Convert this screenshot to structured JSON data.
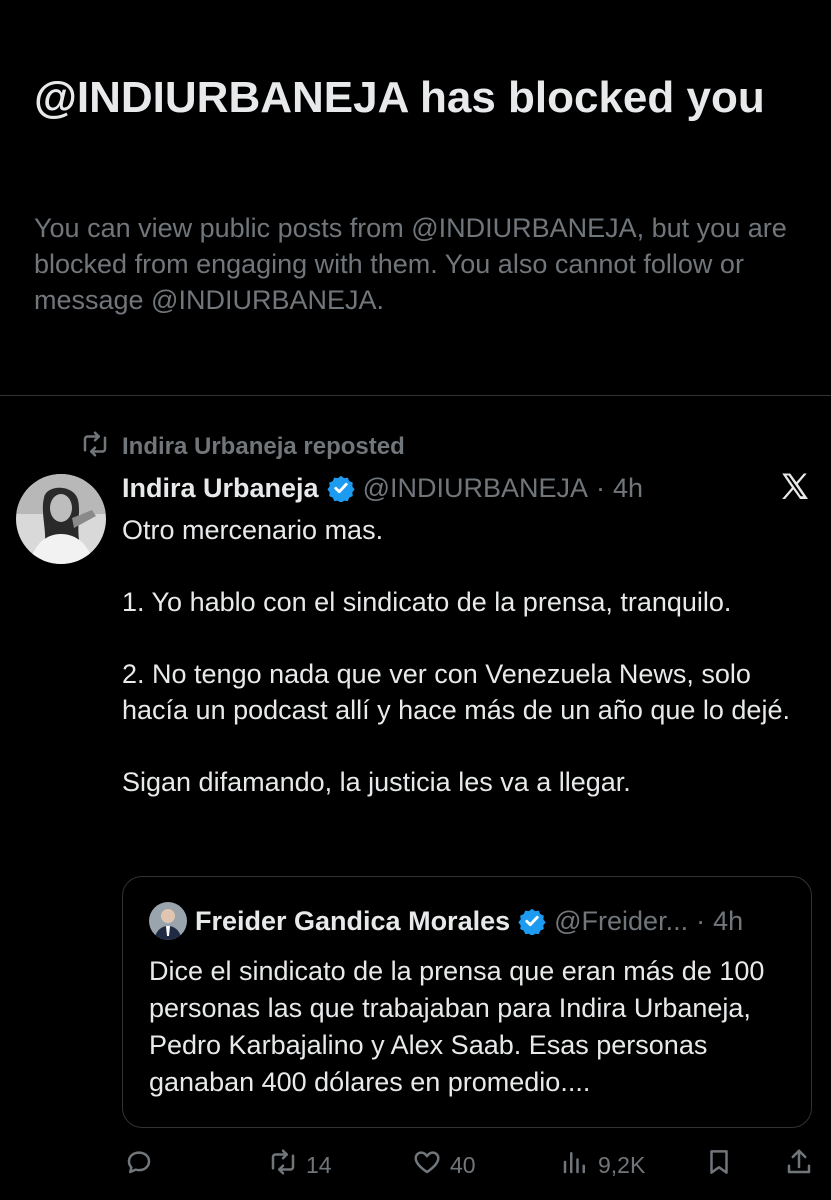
{
  "blocked_notice": {
    "title": "@INDIURBANEJA has blocked you",
    "description": "You can view public posts from @INDIURBANEJA, but you are blocked from engaging with them. You also cannot follow or message @INDIURBANEJA."
  },
  "post": {
    "repost_label": "Indira Urbaneja reposted",
    "author_name": "Indira Urbaneja",
    "handle": "@INDIURBANEJA",
    "separator": "·",
    "time": "4h",
    "body": [
      "Otro mercenario mas.",
      "1. Yo hablo con el sindicato de la prensa, tranquilo.",
      "2. No tengo nada que ver con Venezuela News, solo hacía un podcast allí y hace más de un año que lo dejé.",
      "Sigan difamando, la justicia les va a llegar."
    ],
    "quote": {
      "author_name": "Freider Gandica Morales",
      "handle": "@Freider...",
      "separator": "·",
      "time": "4h",
      "body": "Dice el sindicato de la prensa que eran más de 100 personas las que trabajaban para Indira Urbaneja, Pedro Karbajalino y Alex Saab. Esas personas ganaban 400 dólares en promedio...."
    },
    "actions": {
      "reply_count": "",
      "repost_count": "14",
      "like_count": "40",
      "views_count": "9,2K"
    }
  },
  "icons": {
    "repost": "repost-icon",
    "verified": "verified-badge-icon",
    "logo": "x-logo-icon",
    "reply": "reply-icon",
    "like": "heart-icon",
    "views": "views-icon",
    "bookmark": "bookmark-icon",
    "share": "share-icon"
  },
  "colors": {
    "background": "#000000",
    "primary_text": "#e7e9ea",
    "secondary_text": "#71767b",
    "border": "#2f3336",
    "verified": "#1d9bf0"
  }
}
